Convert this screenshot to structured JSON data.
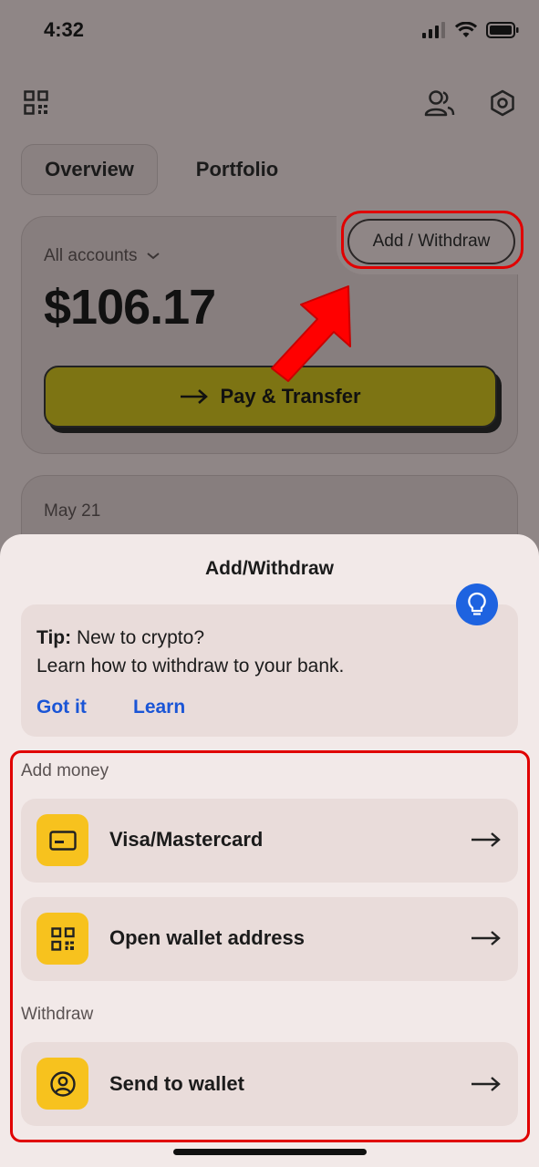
{
  "status_bar": {
    "time": "4:32"
  },
  "tabs": [
    {
      "label": "Overview",
      "active": true
    },
    {
      "label": "Portfolio",
      "active": false
    }
  ],
  "balance_card": {
    "accounts_label": "All accounts",
    "balance": "$106.17",
    "pay_label": "Pay & Transfer",
    "add_withdraw_label": "Add / Withdraw"
  },
  "activity": {
    "date": "May 21"
  },
  "sheet": {
    "title": "Add/Withdraw",
    "tip": {
      "prefix": "Tip:",
      "line1": " New to crypto?",
      "line2": "Learn how to withdraw to your bank.",
      "got_it": "Got it",
      "learn": "Learn"
    },
    "add_section": {
      "label": "Add money",
      "items": [
        {
          "label": "Visa/Mastercard",
          "icon": "card-icon"
        },
        {
          "label": "Open wallet address",
          "icon": "qr-icon"
        }
      ]
    },
    "withdraw_section": {
      "label": "Withdraw",
      "items": [
        {
          "label": "Send to wallet",
          "icon": "user-circle-icon"
        }
      ]
    }
  },
  "colors": {
    "accent_blue": "#1a55d6",
    "icon_yellow": "#f7c21e",
    "highlight_red": "#e00000"
  }
}
